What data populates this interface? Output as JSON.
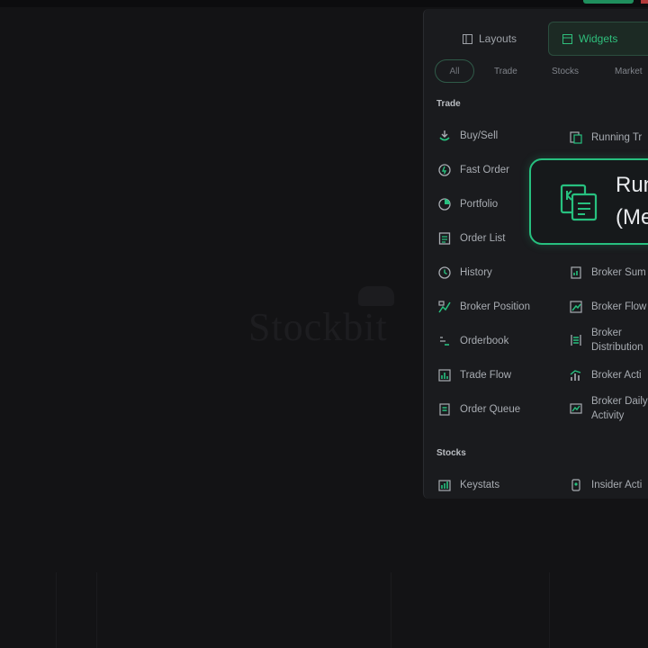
{
  "watermark": {
    "text": "Stockbit"
  },
  "tabs": {
    "layouts": "Layouts",
    "widgets": "Widgets"
  },
  "filters": {
    "all": "All",
    "trade": "Trade",
    "stocks": "Stocks",
    "market": "Market"
  },
  "sections": {
    "trade": "Trade",
    "stocks": "Stocks"
  },
  "trade_left": [
    {
      "label": "Buy/Sell",
      "icon": "buy-sell-icon"
    },
    {
      "label": "Fast Order",
      "icon": "fast-order-icon"
    },
    {
      "label": "Portfolio",
      "icon": "portfolio-icon"
    },
    {
      "label": "Order List",
      "icon": "order-list-icon"
    },
    {
      "label": "History",
      "icon": "history-icon"
    },
    {
      "label": "Broker Position",
      "icon": "broker-position-icon"
    },
    {
      "label": "Orderbook",
      "icon": "orderbook-icon"
    },
    {
      "label": "Trade Flow",
      "icon": "trade-flow-icon"
    },
    {
      "label": "Order Queue",
      "icon": "order-queue-icon"
    }
  ],
  "trade_right": [
    {
      "label": "Running Tr",
      "icon": "running-trade-icon"
    },
    {
      "label": "Broker Sum",
      "icon": "broker-summary-icon"
    },
    {
      "label": "Broker Flow",
      "icon": "broker-flow-icon"
    },
    {
      "label": "Broker",
      "label2": "Distribution",
      "icon": "broker-distribution-icon"
    },
    {
      "label": "Broker Acti",
      "icon": "broker-activity-icon"
    },
    {
      "label": "Broker Daily",
      "label2": "Activity",
      "icon": "broker-daily-activity-icon"
    }
  ],
  "stocks_left": [
    {
      "label": "Keystats",
      "icon": "keystats-icon"
    }
  ],
  "stocks_right": [
    {
      "label": "Insider Acti",
      "icon": "insider-activity-icon"
    }
  ],
  "highlight": {
    "line1": "Run",
    "line2": "(Me",
    "icon": "running-trade-icon"
  },
  "colors": {
    "accent": "#27c07f",
    "background": "#131315",
    "panel": "#1a1b1e"
  }
}
